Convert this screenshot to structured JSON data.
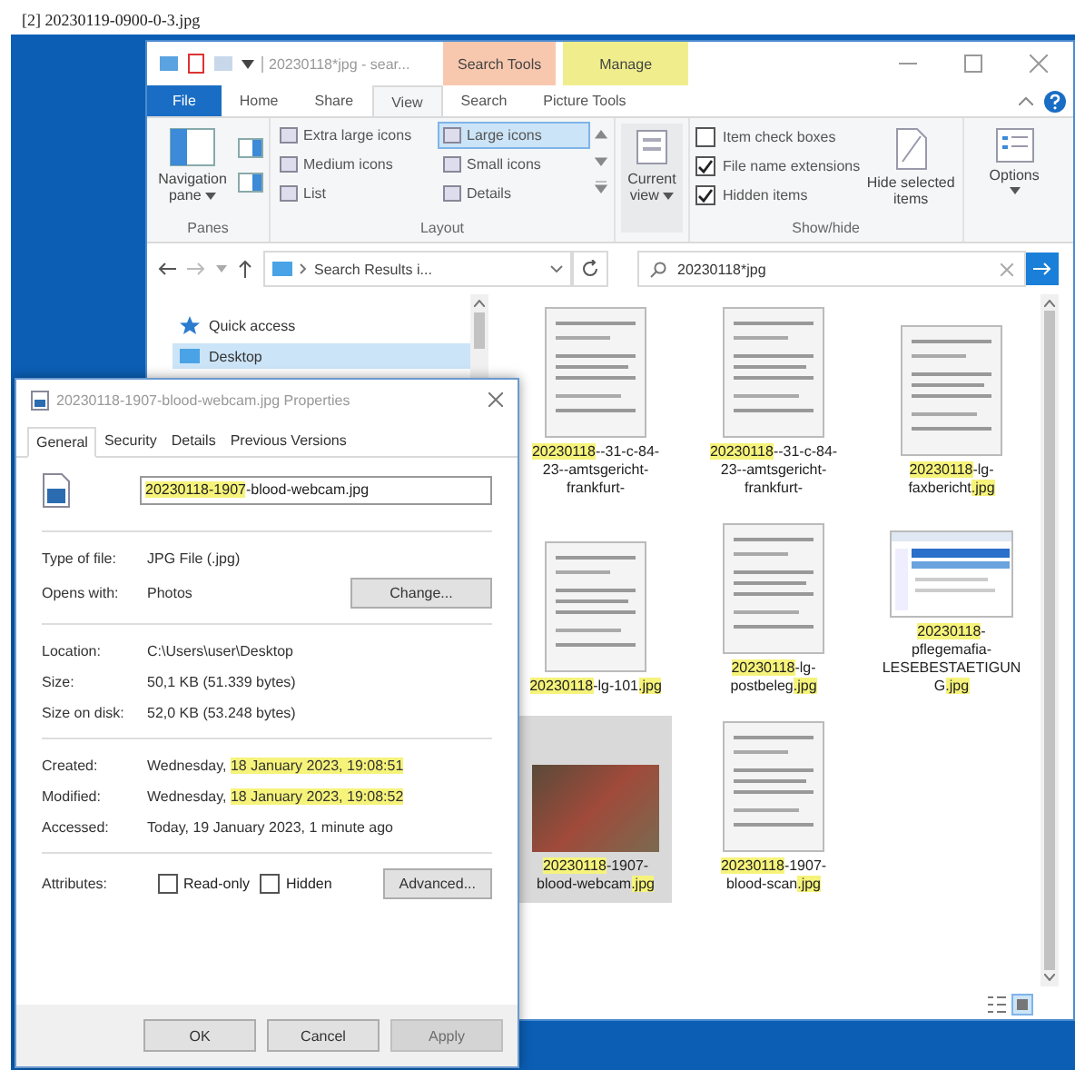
{
  "caption": "[2] 20230119-0900-0-3.jpg",
  "explorer": {
    "title": "20230118*jpg - sear...",
    "context_tabs": [
      {
        "label": "Search Tools",
        "color": "#f8c8ae"
      },
      {
        "label": "Manage",
        "color": "#f0ee8c"
      }
    ],
    "file_tab": "File",
    "ribbon_tabs": [
      {
        "label": "Home",
        "selected": false
      },
      {
        "label": "Share",
        "selected": false
      },
      {
        "label": "View",
        "selected": true
      },
      {
        "label": "Search",
        "selected": false
      },
      {
        "label": "Picture Tools",
        "selected": false
      }
    ],
    "panes": {
      "navigation_pane": "Navigation pane",
      "label": "Panes"
    },
    "layout": {
      "label": "Layout",
      "options": [
        {
          "label": "Extra large icons",
          "selected": false
        },
        {
          "label": "Large icons",
          "selected": true
        },
        {
          "label": "Medium icons",
          "selected": false
        },
        {
          "label": "Small icons",
          "selected": false
        },
        {
          "label": "List",
          "selected": false
        },
        {
          "label": "Details",
          "selected": false
        }
      ]
    },
    "current_view": "Current view",
    "show_hide": {
      "label": "Show/hide",
      "checks": [
        {
          "label": "Item check boxes",
          "checked": false
        },
        {
          "label": "File name extensions",
          "checked": true
        },
        {
          "label": "Hidden items",
          "checked": true
        }
      ],
      "hide_selected": "Hide selected items"
    },
    "options": "Options",
    "address": "Search Results i...",
    "search": "20230118*jpg",
    "nav": [
      {
        "label": "Quick access",
        "selected": false
      },
      {
        "label": "Desktop",
        "selected": true
      }
    ],
    "files": [
      {
        "kind": "document",
        "selected": false,
        "name": [
          {
            "text": "20230118",
            "hl": true
          },
          {
            "text": "--31-c-84-23--amtsgericht-frankfurt-",
            "hl": false
          }
        ]
      },
      {
        "kind": "document",
        "selected": false,
        "name": [
          {
            "text": "20230118",
            "hl": true
          },
          {
            "text": "--31-c-84-23--amtsgericht-frankfurt-",
            "hl": false
          }
        ]
      },
      {
        "kind": "document",
        "selected": false,
        "name": [
          {
            "text": "20230118",
            "hl": true
          },
          {
            "text": "-lg-faxbericht",
            "hl": false
          },
          {
            "text": ".jpg",
            "hl": true
          }
        ]
      },
      {
        "kind": "document",
        "selected": false,
        "name": [
          {
            "text": "20230118",
            "hl": true
          },
          {
            "text": "-lg-101",
            "hl": false
          },
          {
            "text": ".jpg",
            "hl": true
          }
        ]
      },
      {
        "kind": "document",
        "selected": false,
        "name": [
          {
            "text": "20230118",
            "hl": true
          },
          {
            "text": "-lg-postbeleg",
            "hl": false
          },
          {
            "text": ".jpg",
            "hl": true
          }
        ]
      },
      {
        "kind": "screenshot",
        "selected": false,
        "name": [
          {
            "text": "20230118",
            "hl": true
          },
          {
            "text": "-pflegemafia-LESEBESTAETIGUNG",
            "hl": false
          },
          {
            "text": ".jpg",
            "hl": true
          }
        ]
      },
      {
        "kind": "photo",
        "selected": true,
        "name": [
          {
            "text": "20230118",
            "hl": true
          },
          {
            "text": "-1907-blood-webcam",
            "hl": false
          },
          {
            "text": ".jpg",
            "hl": true
          }
        ]
      },
      {
        "kind": "document",
        "selected": false,
        "name": [
          {
            "text": "20230118",
            "hl": true
          },
          {
            "text": "-1907-blood-scan",
            "hl": false
          },
          {
            "text": ".jpg",
            "hl": true
          }
        ]
      }
    ]
  },
  "dialog": {
    "title": "20230118-1907-blood-webcam.jpg Properties",
    "tabs": [
      {
        "label": "General",
        "selected": true
      },
      {
        "label": "Security",
        "selected": false
      },
      {
        "label": "Details",
        "selected": false
      },
      {
        "label": "Previous Versions",
        "selected": false
      }
    ],
    "file_name": [
      {
        "text": "20230118-1907",
        "hl": true
      },
      {
        "text": "-blood-webcam.jpg",
        "hl": false
      }
    ],
    "groups": [
      [
        {
          "label": "Type of file:",
          "value": [
            {
              "text": "JPG File (.jpg)",
              "hl": false
            }
          ]
        },
        {
          "label": "Opens with:",
          "value": [
            {
              "text": "Photos",
              "hl": false
            }
          ],
          "button": "Change..."
        }
      ],
      [
        {
          "label": "Location:",
          "value": [
            {
              "text": "C:\\Users\\user\\Desktop",
              "hl": false
            }
          ]
        },
        {
          "label": "Size:",
          "value": [
            {
              "text": "50,1 KB (51.339 bytes)",
              "hl": false
            }
          ]
        },
        {
          "label": "Size on disk:",
          "value": [
            {
              "text": "52,0 KB (53.248 bytes)",
              "hl": false
            }
          ]
        }
      ],
      [
        {
          "label": "Created:",
          "value": [
            {
              "text": "Wednesday, ",
              "hl": false
            },
            {
              "text": "18 January 2023, 19:08:51",
              "hl": true
            }
          ]
        },
        {
          "label": "Modified:",
          "value": [
            {
              "text": "Wednesday, ",
              "hl": false
            },
            {
              "text": "18 January 2023, 19:08:52",
              "hl": true
            }
          ]
        },
        {
          "label": "Accessed:",
          "value": [
            {
              "text": "Today, 19 January 2023, 1 minute ago",
              "hl": false
            }
          ]
        }
      ]
    ],
    "attributes": {
      "label": "Attributes:",
      "checks": [
        {
          "label": "Read-only",
          "checked": false
        },
        {
          "label": "Hidden",
          "checked": false
        }
      ],
      "advanced": "Advanced..."
    },
    "buttons": [
      {
        "label": "OK",
        "disabled": false
      },
      {
        "label": "Cancel",
        "disabled": false
      },
      {
        "label": "Apply",
        "disabled": true
      }
    ]
  }
}
